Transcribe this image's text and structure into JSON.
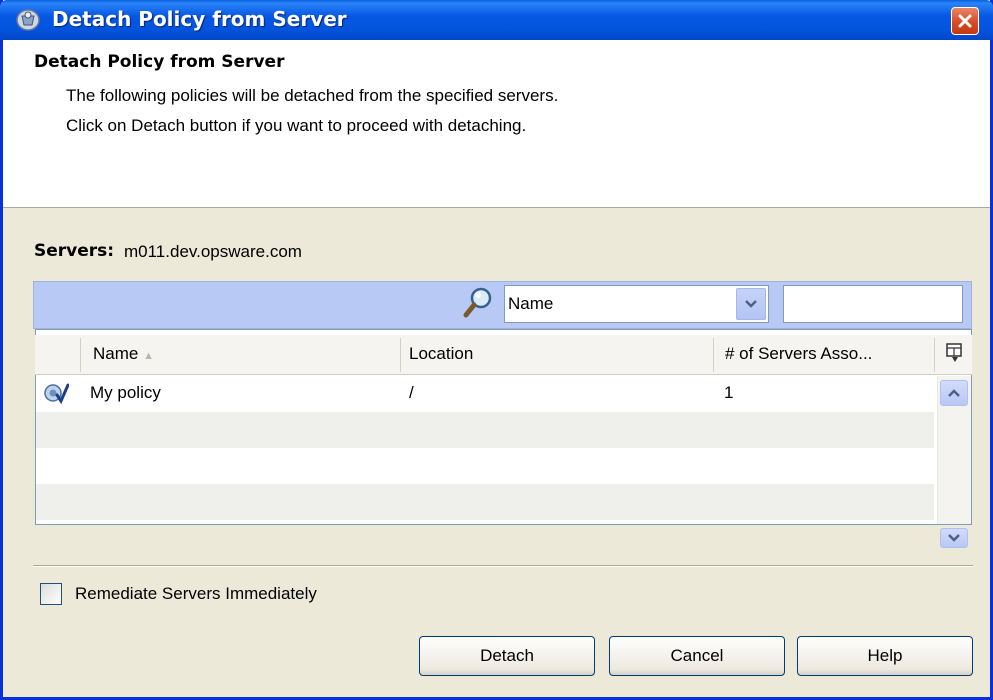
{
  "window": {
    "title": "Detach Policy from Server",
    "close_icon": "close-icon"
  },
  "header": {
    "title": "Detach Policy from Server",
    "description_line1": "The following policies will be detached from the specified servers.",
    "description_line2": "Click on Detach button if you want to proceed with detaching."
  },
  "servers": {
    "label": "Servers:",
    "value": "m011.dev.opsware.com"
  },
  "filter": {
    "field_selected": "Name",
    "text_value": ""
  },
  "table": {
    "columns": [
      "Name",
      "Location",
      "# of Servers Asso..."
    ],
    "sort_indicator": "▲",
    "rows": [
      {
        "icon": "policy-icon",
        "name": "My policy",
        "location": "/",
        "servers": "1"
      }
    ]
  },
  "options": {
    "remediate_label": "Remediate Servers Immediately",
    "remediate_checked": false
  },
  "buttons": {
    "detach": "Detach",
    "cancel": "Cancel",
    "help": "Help"
  },
  "colors": {
    "titlebar": "#0757e3",
    "filter_bar": "#b9c9f5",
    "close_button": "#d84a22"
  }
}
